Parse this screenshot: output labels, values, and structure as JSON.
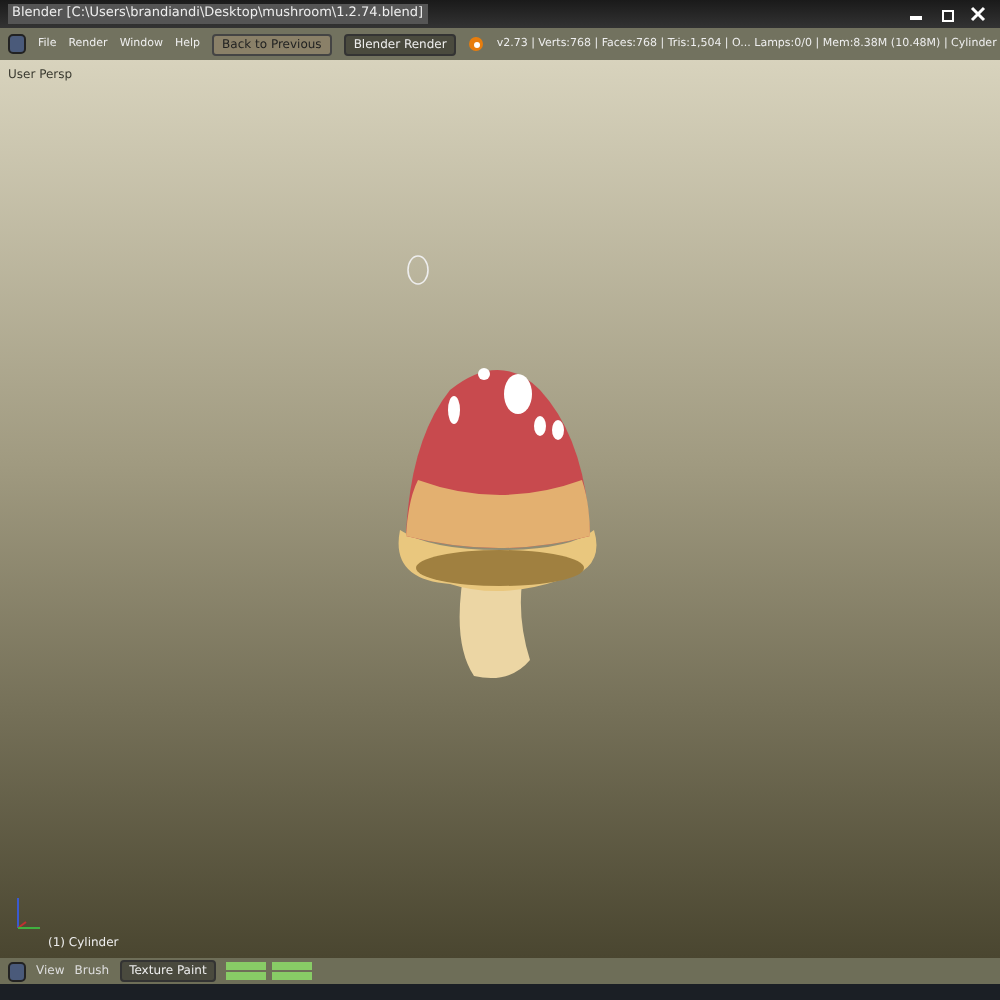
{
  "window": {
    "title": "Blender [C:\\Users\\brandiandi\\Desktop\\mushroom\\1.2.74.blend]"
  },
  "menu": [
    "File",
    "Render",
    "Window",
    "Help"
  ],
  "back_button": "Back to Previous",
  "render_engine": "Blender Render",
  "info": "v2.73 | Verts:768 | Faces:768 | Tris:1,504 | O... Lamps:0/0 | Mem:8.38M (10.48M) | Cylinder",
  "viewport": {
    "view_label": "User Persp",
    "object_label": "(1) Cylinder"
  },
  "bottom_header": {
    "menu": [
      "View",
      "Brush"
    ],
    "mode": "Texture Paint"
  }
}
